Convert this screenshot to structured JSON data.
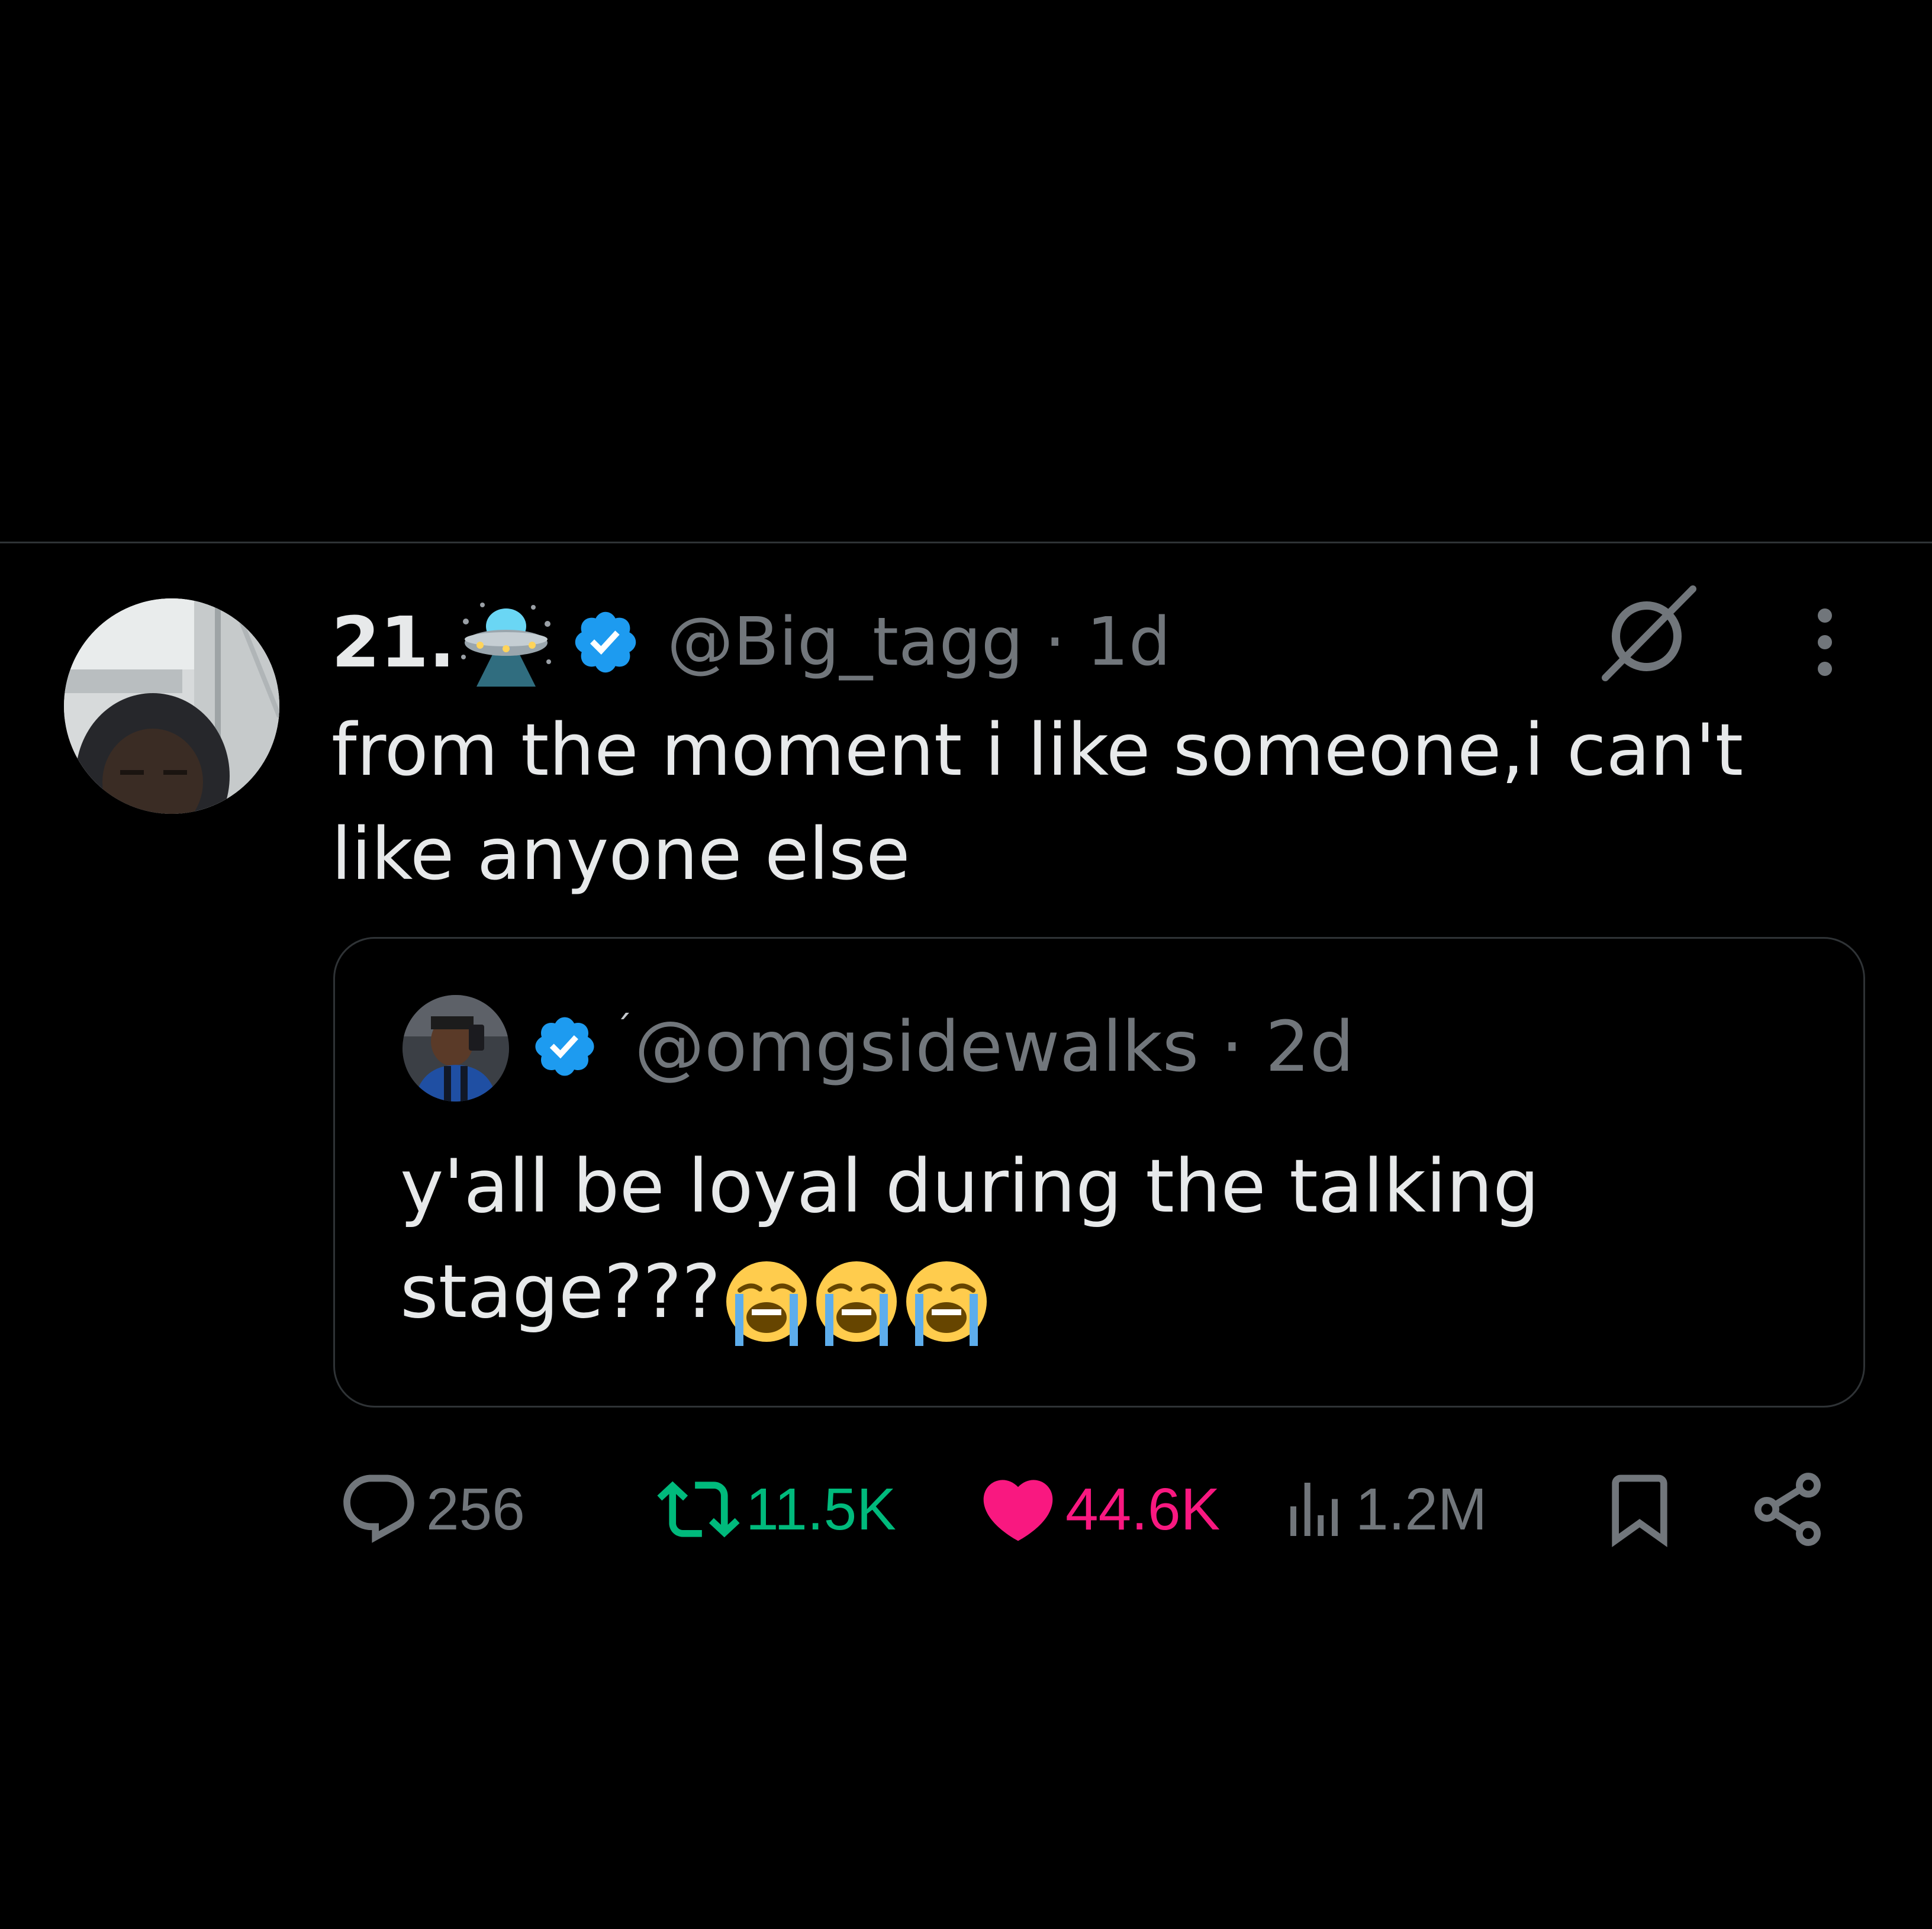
{
  "tweet": {
    "display_name": "21.",
    "handle": "@Big_tagg",
    "separator": "·",
    "time": "1d",
    "text": "from the moment i like someone,i can't like anyone else",
    "display_name_icon": "flying-saucer-emoji",
    "badge_icon": "verified-badge"
  },
  "quoted": {
    "handle": "@omgsidewalks",
    "separator": "·",
    "time": "2d",
    "text": "y'all be loyal during the talking stage???",
    "emojis": [
      "loudly-crying-face",
      "loudly-crying-face",
      "loudly-crying-face"
    ],
    "badge_icon": "verified-badge"
  },
  "actions": {
    "replies": "256",
    "retweets": "11.5K",
    "likes": "44.6K",
    "views": "1.2M"
  },
  "colors": {
    "background": "#000000",
    "text_primary": "#e7e9ea",
    "text_secondary": "#71767b",
    "border": "#2f3336",
    "verified": "#1d9bf0",
    "retweet": "#00ba7c",
    "like": "#f91880"
  },
  "icons": [
    "grok-icon",
    "more-options-icon",
    "reply-icon",
    "retweet-icon",
    "heart-icon",
    "views-icon",
    "bookmark-icon",
    "share-icon"
  ]
}
